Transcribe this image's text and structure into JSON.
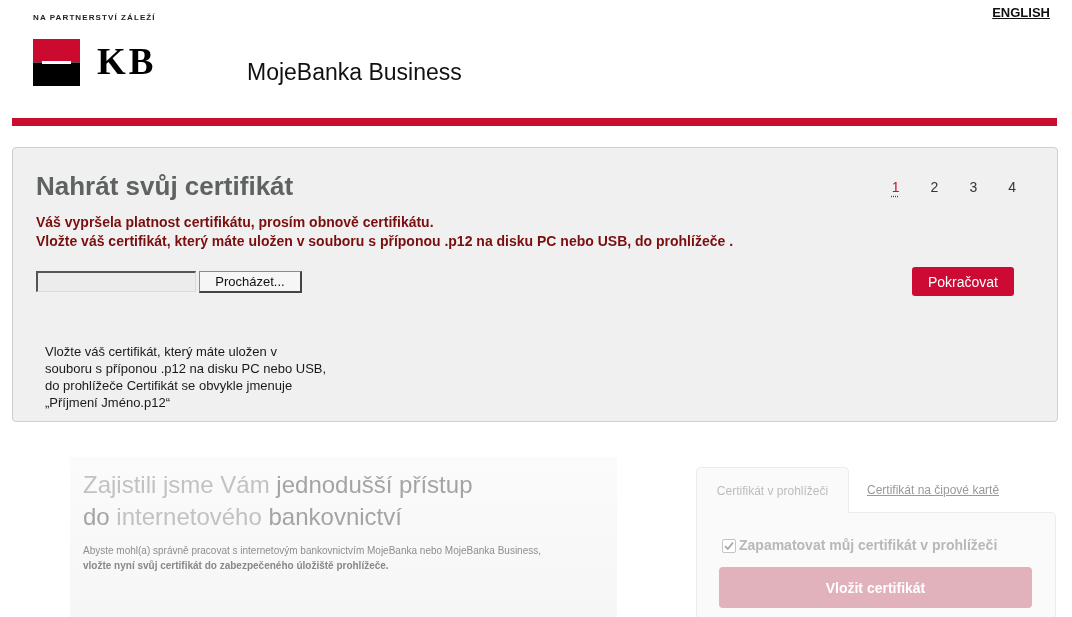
{
  "header": {
    "tagline": "NA PARTNERSTVÍ ZÁLEŽÍ",
    "logo_text": "KB",
    "product_name": "MojeBanka Business",
    "language_link": "ENGLISH"
  },
  "upload_panel": {
    "title": "Nahrát svůj certifikát",
    "steps": [
      {
        "label": "1",
        "selected": true
      },
      {
        "label": "2",
        "selected": false
      },
      {
        "label": "3",
        "selected": false
      },
      {
        "label": "4",
        "selected": false
      }
    ],
    "messages": [
      "Váš vypršela platnost certifikátu, prosím obnově certifikátu.",
      "Vložte váš certifikát, který máte uložen v souboru s příponou .p12 na disku PC nebo USB, do prohlížeče ."
    ],
    "file_field": {
      "browse_button": "Procházet..."
    },
    "continue_button": "Pokračovat",
    "help_text_lines": [
      "Vložte váš certifikát, který máte uložen v",
      "souboru s příponou .p12 na disku PC nebo USB,",
      "do prohlížeče Certifikát se obvykle jmenuje",
      "„Příjmení Jméno.p12“"
    ]
  },
  "promo_banner": {
    "headline_lines": [
      "Zajistili jsme Vám **jednodušší přístup**",
      "**do** internetového **bankovnictví**"
    ],
    "text": "Abyste mohl(a) správně pracovat s internetovým bankovnictvím MojeBanka nebo MojeBanka Business, **vložte nyní svůj certifikát do zabezpečeného úložiště prohlížeče.**"
  },
  "certificate_login": {
    "tabs": [
      {
        "label": "Certifikát v prohlížeči",
        "selected": true
      },
      {
        "label": "Certifikát na čipové kartě",
        "selected": false
      }
    ],
    "remember_checkbox": {
      "label": "Zapamatovat můj certifikát v prohlížeči",
      "checked": true
    },
    "submit_button": "Vložit certifikát"
  }
}
